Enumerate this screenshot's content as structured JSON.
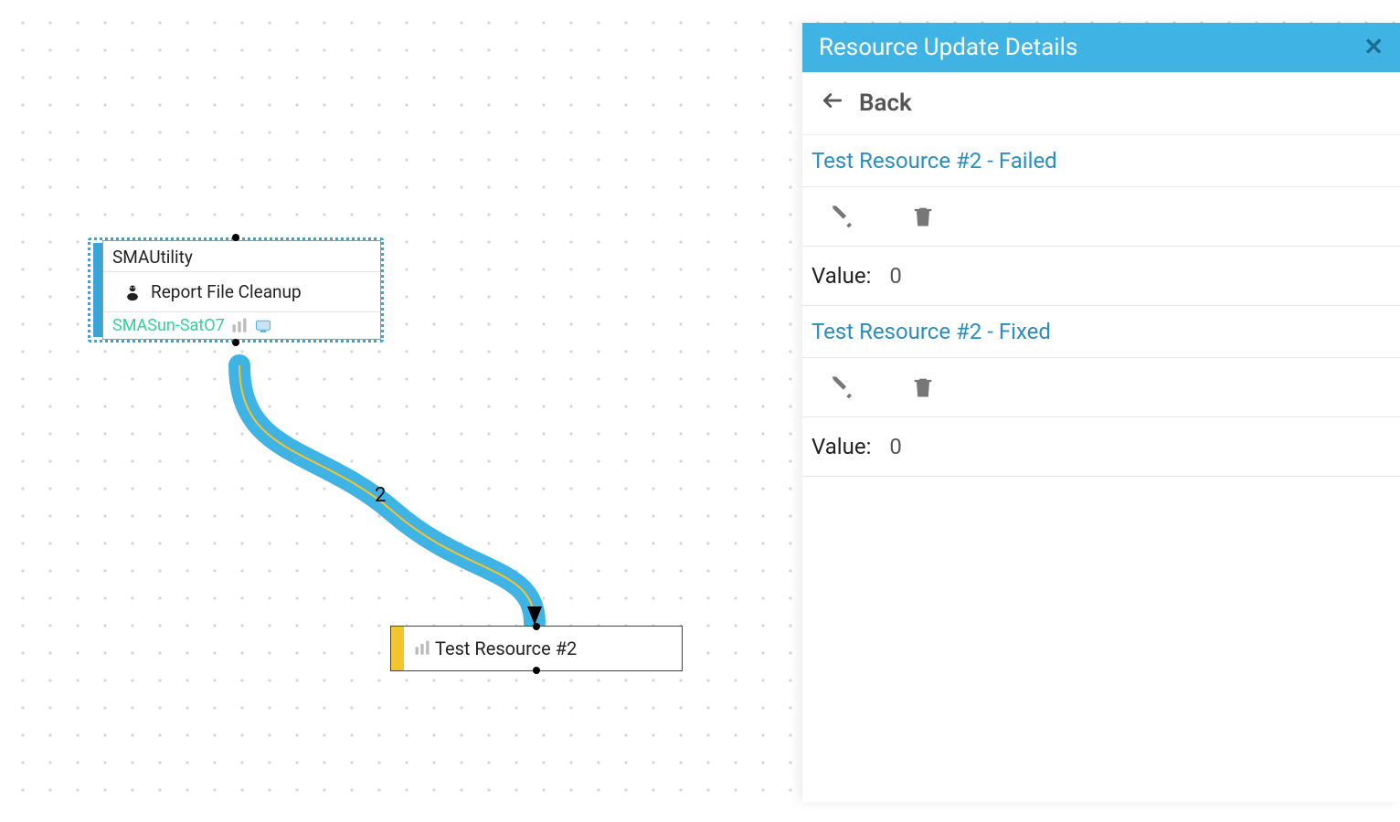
{
  "canvas": {
    "node1": {
      "title": "SMAUtility",
      "job": "Report File Cleanup",
      "footer": "SMASun-SatO7"
    },
    "node2": {
      "label": "Test Resource #2"
    },
    "edge_label": "2"
  },
  "panel": {
    "title": "Resource Update Details",
    "back_label": "Back",
    "sections": [
      {
        "title": "Test Resource #2 - Failed",
        "value_label": "Value:",
        "value": "0"
      },
      {
        "title": "Test Resource #2 - Fixed",
        "value_label": "Value:",
        "value": "0"
      }
    ]
  }
}
